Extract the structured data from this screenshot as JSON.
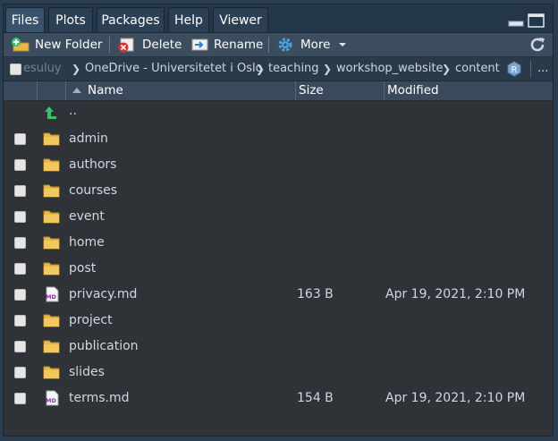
{
  "tabs": [
    {
      "label": "Files",
      "active": true
    },
    {
      "label": "Plots",
      "active": false
    },
    {
      "label": "Packages",
      "active": false
    },
    {
      "label": "Help",
      "active": false
    },
    {
      "label": "Viewer",
      "active": false
    }
  ],
  "toolbar": {
    "new_folder": "New Folder",
    "delete": "Delete",
    "rename": "Rename",
    "more": "More"
  },
  "breadcrumb": {
    "items": [
      "esuluy",
      "OneDrive - Universitetet i Oslo",
      "teaching",
      "workshop_website",
      "content"
    ],
    "overflow": "..."
  },
  "columns": {
    "name": "Name",
    "size": "Size",
    "modified": "Modified"
  },
  "parent_label": "..",
  "files": [
    {
      "name": "admin",
      "type": "folder",
      "size": "",
      "modified": ""
    },
    {
      "name": "authors",
      "type": "folder",
      "size": "",
      "modified": ""
    },
    {
      "name": "courses",
      "type": "folder",
      "size": "",
      "modified": ""
    },
    {
      "name": "event",
      "type": "folder",
      "size": "",
      "modified": ""
    },
    {
      "name": "home",
      "type": "folder",
      "size": "",
      "modified": ""
    },
    {
      "name": "post",
      "type": "folder",
      "size": "",
      "modified": ""
    },
    {
      "name": "privacy.md",
      "type": "md",
      "size": "163 B",
      "modified": "Apr 19, 2021, 2:10 PM"
    },
    {
      "name": "project",
      "type": "folder",
      "size": "",
      "modified": ""
    },
    {
      "name": "publication",
      "type": "folder",
      "size": "",
      "modified": ""
    },
    {
      "name": "slides",
      "type": "folder",
      "size": "",
      "modified": ""
    },
    {
      "name": "terms.md",
      "type": "md",
      "size": "154 B",
      "modified": "Apr 19, 2021, 2:10 PM"
    }
  ],
  "colors": {
    "background": "#2f3237",
    "toolbar": "#3b4d5f",
    "folder": "#e8b94a",
    "accent_green": "#3fbf6f"
  }
}
